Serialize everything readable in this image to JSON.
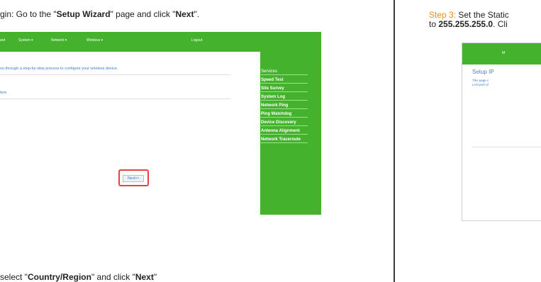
{
  "left": {
    "step_line_part1": "gin: Go to the \"",
    "step_line_bold1": "Setup Wizard",
    "step_line_part2": "\" page and click \"",
    "step_line_bold2": "Next",
    "step_line_part3": "\".",
    "bottom_part1": "select \"",
    "bottom_bold1": "Country/Region",
    "bottom_part2": "\" and click \"",
    "bottom_bold2": "Next",
    "bottom_part3": "\"",
    "screenshot": {
      "nav": [
        "ard",
        "System ▾",
        "Network ▾",
        "Wireless ▾",
        "Logout"
      ],
      "intro_text": "ou through a step-by-step process to configure your wireless device.",
      "sub_text": "ters",
      "next_button": "Next>>",
      "menu": [
        "Services",
        "Speed Test",
        "Site Survey",
        "System Log",
        "Network Ping",
        "Ping Watchdog",
        "Device Discovery",
        "Antenna Alignment",
        "Network Traceroute"
      ],
      "colors": {
        "accent": "#45b22d",
        "link": "#3a7bd5",
        "highlight": "#e8423f"
      }
    }
  },
  "right": {
    "step_label": "Step 3:",
    "line1_text": " Set the Static",
    "line2_prefix": "to ",
    "line2_bold": "255.255.255.0",
    "line2_suffix": ". Cli",
    "screenshot": {
      "nav_fragment": "M",
      "title": "Setup IP",
      "desc_line1": "This page c",
      "desc_line2": "LAN port of"
    },
    "colors": {
      "step": "#f08c1b"
    }
  }
}
